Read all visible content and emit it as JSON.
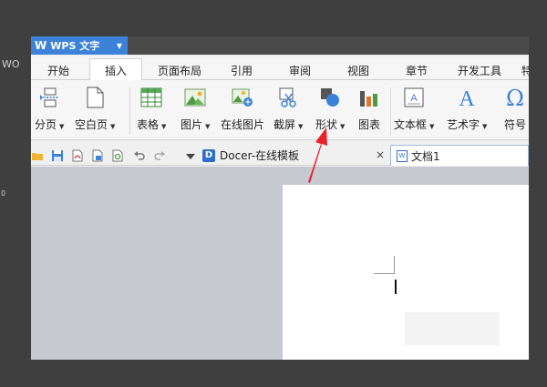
{
  "background_edge": {
    "left_text": "WO",
    "left_dot": "0"
  },
  "titlebar": {
    "app_name": "WPS 文字"
  },
  "tabs": [
    "开始",
    "插入",
    "页面布局",
    "引用",
    "审阅",
    "视图",
    "章节",
    "开发工具",
    "特"
  ],
  "active_tab": "插入",
  "ribbon": {
    "page_break": "分页",
    "blank_page": "空白页",
    "table": "表格",
    "picture": "图片",
    "online_picture": "在线图片",
    "screenshot": "截屏",
    "shapes": "形状",
    "chart": "图表",
    "textbox": "文本框",
    "wordart": "艺术字",
    "symbol": "符号"
  },
  "doc_tabs": {
    "docer": "Docer-在线模板",
    "close_glyph": "×",
    "doc1": "文档1"
  },
  "colors": {
    "accent": "#3b82d8",
    "annotation_arrow": "#e8232b"
  }
}
